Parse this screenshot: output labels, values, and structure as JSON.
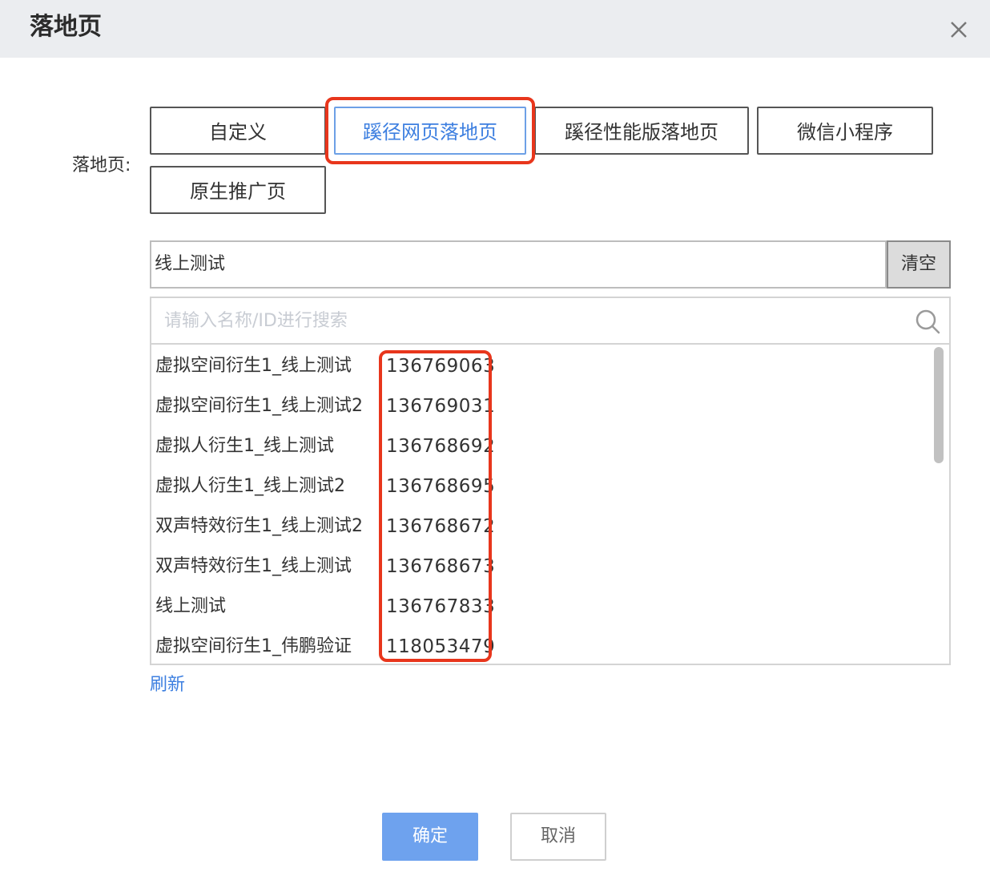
{
  "dialog": {
    "title": "落地页"
  },
  "landing_page": {
    "label": "落地页:",
    "type_buttons": [
      {
        "label": "自定义"
      },
      {
        "label": "蹊径网页落地页",
        "selected": true
      },
      {
        "label": "蹊径性能版落地页"
      },
      {
        "label": "微信小程序"
      },
      {
        "label": "原生推广页"
      }
    ],
    "selected_value": "线上测试",
    "clear_label": "清空",
    "search": {
      "placeholder": "请输入名称/ID进行搜索",
      "value": ""
    },
    "items": [
      {
        "name": "虚拟空间衍生1_线上测试",
        "id": "136769063"
      },
      {
        "name": "虚拟空间衍生1_线上测试2",
        "id": "136769031"
      },
      {
        "name": "虚拟人衍生1_线上测试",
        "id": "136768692"
      },
      {
        "name": "虚拟人衍生1_线上测试2",
        "id": "136768695"
      },
      {
        "name": "双声特效衍生1_线上测试2",
        "id": "136768672"
      },
      {
        "name": "双声特效衍生1_线上测试",
        "id": "136768673"
      },
      {
        "name": "线上测试",
        "id": "136767833"
      },
      {
        "name": "虚拟空间衍生1_伟鹏验证",
        "id": "118053479"
      }
    ],
    "refresh_label": "刷新"
  },
  "footer": {
    "confirm_label": "确定",
    "cancel_label": "取消"
  },
  "colors": {
    "accent": "#3d7fe0",
    "highlight": "#e8361c",
    "confirm_bg": "#6ea2ee"
  },
  "icons": {
    "close": "close-icon",
    "search": "search-icon"
  }
}
